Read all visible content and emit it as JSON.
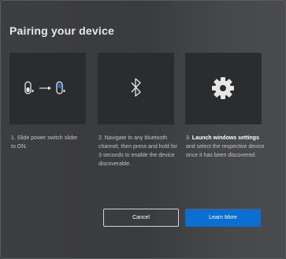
{
  "dialog": {
    "title": "Pairing your device"
  },
  "steps": [
    {
      "icon": "power-switch-slide-icon",
      "text": "1. Slide power switch slider to ON."
    },
    {
      "icon": "bluetooth-icon",
      "text": "2. Navigate to any bluetooth channel, then press and hold for 3 seconds to enable the device discoverable."
    },
    {
      "icon": "gear-icon",
      "text_prefix": "3. ",
      "text_bold": "Launch windows settings",
      "text_suffix": " and select the respective device once it has been discovered."
    }
  ],
  "buttons": {
    "cancel_label": "Cancel",
    "learn_more_label": "Learn More"
  },
  "colors": {
    "accent": "#0a6fd0",
    "card_bg": "#2b2c2e",
    "dialog_bg": "#3a3b3d"
  }
}
